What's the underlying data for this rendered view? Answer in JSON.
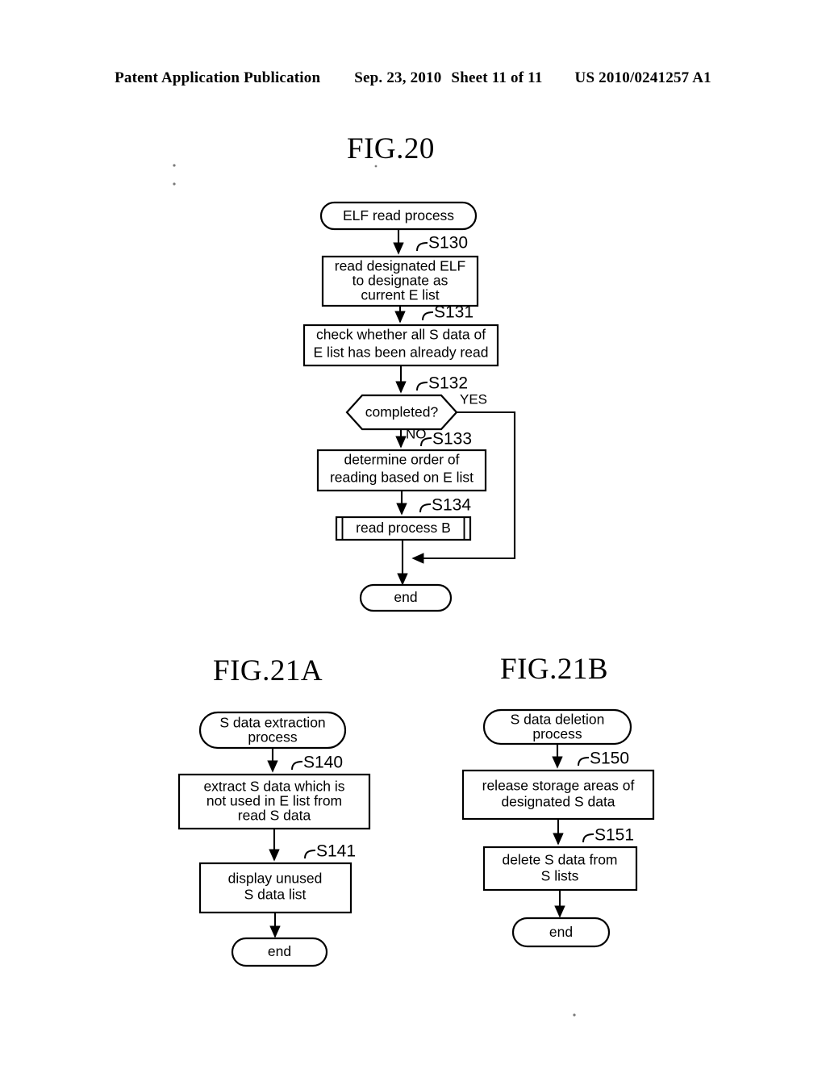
{
  "header": {
    "publication": "Patent Application Publication",
    "date": "Sep. 23, 2010",
    "sheet": "Sheet 11 of 11",
    "number": "US 2010/0241257 A1"
  },
  "figures": {
    "fig20": {
      "title": "FIG.20",
      "nodes": {
        "start": "ELF read process",
        "s130": "read designated ELF\nto designate as\ncurrent E list",
        "s130_line1": "read designated ELF",
        "s130_line2": "to designate as",
        "s130_line3": "current E list",
        "s131_line1": "check whether all S data of",
        "s131_line2": "E list has been already read",
        "s132": "completed?",
        "s133_line1": "determine order of",
        "s133_line2": "reading based on E list",
        "s134": "read process B",
        "end": "end"
      },
      "step_labels": {
        "s130": "S130",
        "s131": "S131",
        "s132": "S132",
        "s133": "S133",
        "s134": "S134"
      },
      "branch_labels": {
        "yes": "YES",
        "no": "NO"
      }
    },
    "fig21a": {
      "title": "FIG.21A",
      "nodes": {
        "start_line1": "S data extraction",
        "start_line2": "process",
        "s140_line1": "extract S data which is",
        "s140_line2": "not used in E list from",
        "s140_line3": "read S data",
        "s141_line1": "display unused",
        "s141_line2": "S data list",
        "end": "end"
      },
      "step_labels": {
        "s140": "S140",
        "s141": "S141"
      }
    },
    "fig21b": {
      "title": "FIG.21B",
      "nodes": {
        "start_line1": "S data deletion",
        "start_line2": "process",
        "s150_line1": "release storage areas of",
        "s150_line2": "designated S data",
        "s151_line1": "delete S data from",
        "s151_line2": "S lists",
        "end": "end"
      },
      "step_labels": {
        "s150": "S150",
        "s151": "S151"
      }
    }
  },
  "colors": {
    "ink": "#000000",
    "paper": "#ffffff"
  }
}
